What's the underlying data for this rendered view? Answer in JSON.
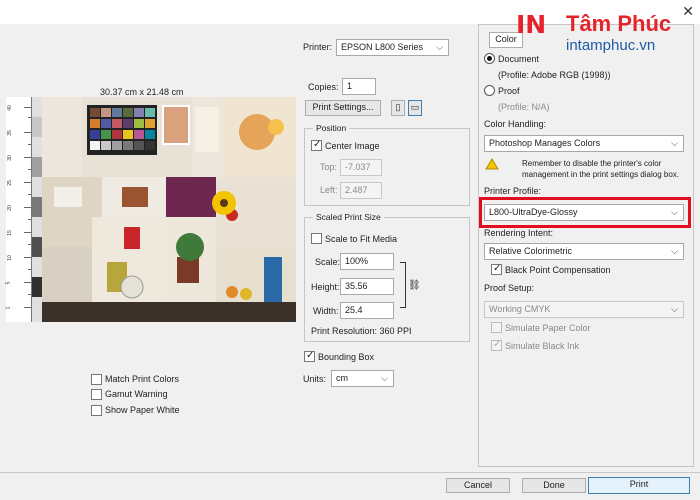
{
  "branding": {
    "mark": "IN",
    "name": "Tâm Phúc",
    "url": "intamphuc.vn"
  },
  "preview": {
    "dimensions": "30.37 cm x 21.48 cm",
    "ruler_numbers": [
      "40",
      "35",
      "30",
      "25",
      "20",
      "15",
      "10",
      "5",
      "1"
    ]
  },
  "printer": {
    "label": "Printer:",
    "value": "EPSON L800 Series"
  },
  "copies": {
    "label": "Copies:",
    "value": "1"
  },
  "print_settings_button": "Print Settings...",
  "position": {
    "title": "Position",
    "center_image": "Center Image",
    "top_label": "Top:",
    "top_value": "-7.037",
    "left_label": "Left:",
    "left_value": "2.487"
  },
  "scaled": {
    "title": "Scaled Print Size",
    "scale_to_fit": "Scale to Fit Media",
    "scale_label": "Scale:",
    "scale_value": "100%",
    "height_label": "Height:",
    "height_value": "35.56",
    "width_label": "Width:",
    "width_value": "25.4",
    "resolution": "Print Resolution: 360 PPI"
  },
  "bounding_box": "Bounding Box",
  "units": {
    "label": "Units:",
    "value": "cm"
  },
  "proof_options": {
    "match_print_colors": "Match Print Colors",
    "gamut_warning": "Gamut Warning",
    "show_paper_white": "Show Paper White"
  },
  "color_panel": {
    "tab": "Color",
    "document": "Document",
    "document_profile": "(Profile: Adobe RGB (1998))",
    "proof": "Proof",
    "proof_profile": "(Profile: N/A)",
    "color_handling_label": "Color Handling:",
    "color_handling_value": "Photoshop Manages Colors",
    "reminder": "Remember to disable the printer's color management in the print settings dialog box.",
    "printer_profile_label": "Printer Profile:",
    "printer_profile_value": "L800-UltraDye-Glossy",
    "rendering_intent_label": "Rendering Intent:",
    "rendering_intent_value": "Relative Colorimetric",
    "black_point": "Black Point Compensation",
    "proof_setup_label": "Proof Setup:",
    "proof_setup_value": "Working CMYK",
    "simulate_paper_color": "Simulate Paper Color",
    "simulate_black_ink": "Simulate Black Ink"
  },
  "footer": {
    "cancel": "Cancel",
    "done": "Done",
    "print": "Print"
  },
  "colors": {
    "accent_red": "#e10e20",
    "brand_red": "#e4242a",
    "brand_blue": "#1f5aa6"
  }
}
